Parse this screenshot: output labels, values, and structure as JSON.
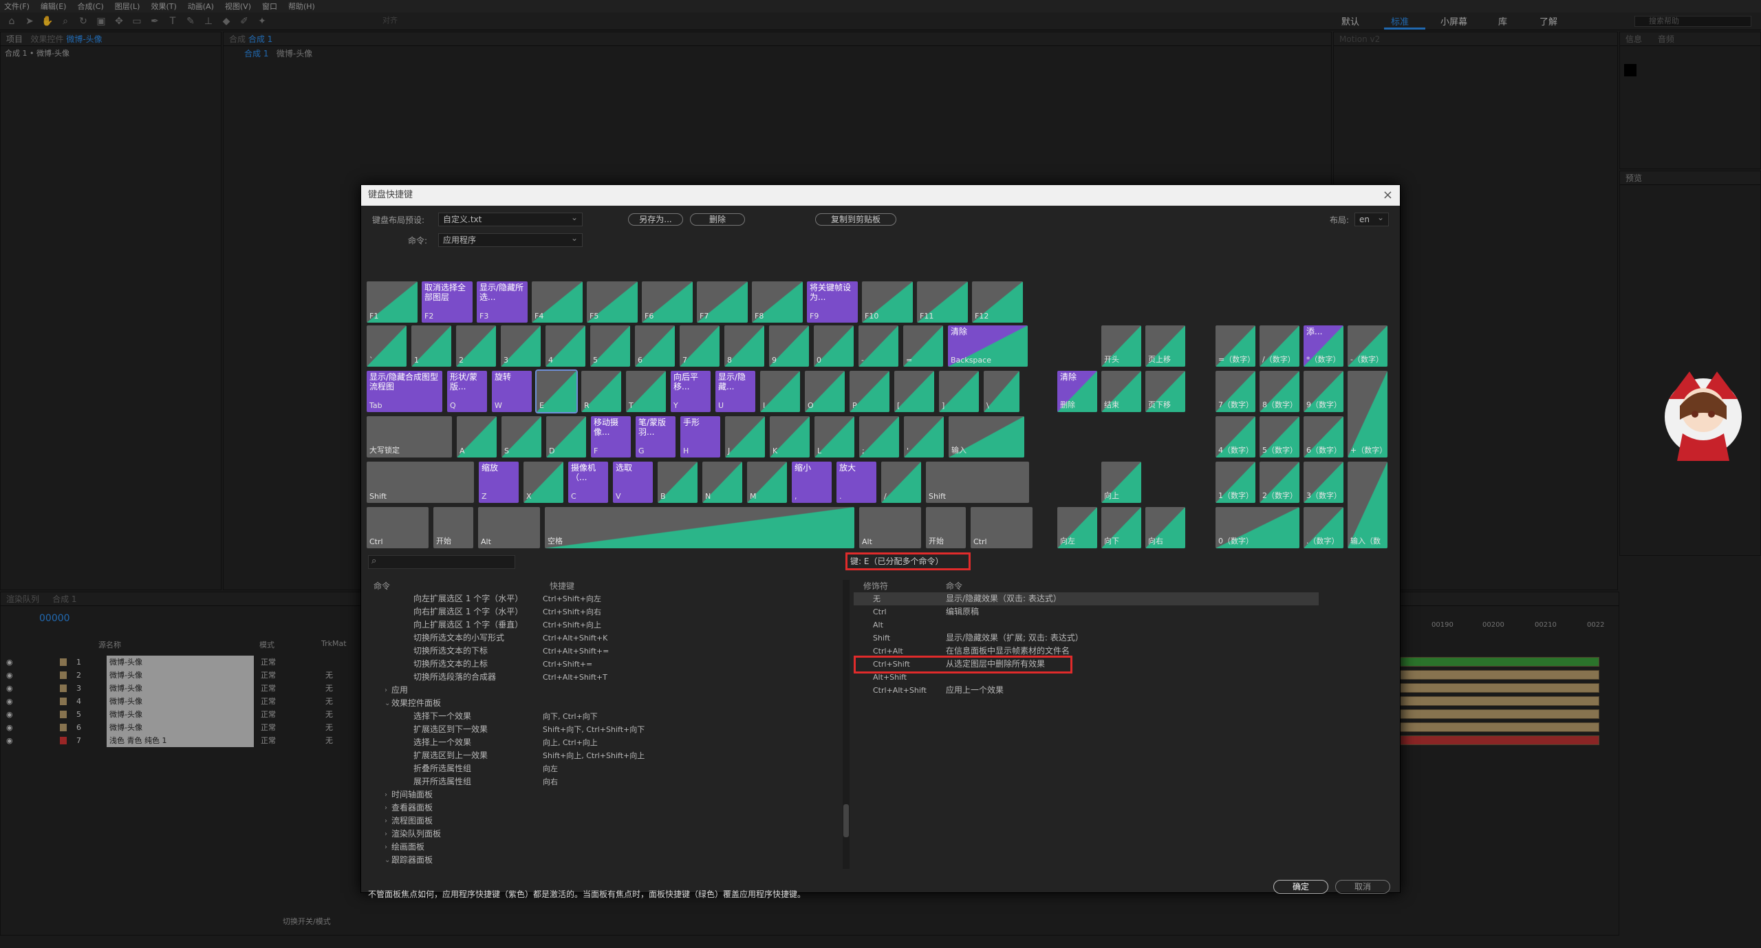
{
  "menu": [
    "文件(F)",
    "编辑(E)",
    "合成(C)",
    "图层(L)",
    "效果(T)",
    "动画(A)",
    "视图(V)",
    "窗口",
    "帮助(H)"
  ],
  "toolbar": {
    "snap": "对齐",
    "search_help": "搜索帮助"
  },
  "workspaces": [
    "默认",
    "标准",
    "小屏幕",
    "库",
    "了解"
  ],
  "panels": {
    "project_tab": "项目",
    "effects_controls_tab": "效果控件",
    "effects_controls_target": "微博-头像",
    "comp_breadcrumb": "合成 1 • 微博-头像",
    "comp_prefix": "合成",
    "comp_name": "合成 1",
    "comp_nav_1": "合成 1",
    "comp_nav_2": "微博-头像",
    "motion_title": "Motion v2",
    "info_tab": "信息",
    "audio_tab": "音频",
    "preview_tab": "预览"
  },
  "timeline": {
    "render_tab": "渲染队列",
    "comp_tab": "合成 1",
    "timecode": "00000",
    "col_source": "源名称",
    "col_mode": "模式",
    "col_trkmat": "TrkMat",
    "toggle_modes": "切换开关/模式",
    "ruler": [
      "00190",
      "00200",
      "00210",
      "0022"
    ],
    "layers": [
      {
        "num": "1",
        "name": "微博-头像",
        "mode": "正常",
        "trk": ""
      },
      {
        "num": "2",
        "name": "微博-头像",
        "mode": "正常",
        "trk": "无"
      },
      {
        "num": "3",
        "name": "微博-头像",
        "mode": "正常",
        "trk": "无"
      },
      {
        "num": "4",
        "name": "微博-头像",
        "mode": "正常",
        "trk": "无"
      },
      {
        "num": "5",
        "name": "微博-头像",
        "mode": "正常",
        "trk": "无"
      },
      {
        "num": "6",
        "name": "微博-头像",
        "mode": "正常",
        "trk": "无"
      },
      {
        "num": "7",
        "name": "浅色 青色 纯色 1",
        "mode": "正常",
        "trk": "无"
      }
    ]
  },
  "dialog": {
    "title": "键盘快捷键",
    "preset_label": "键盘布局预设:",
    "preset_value": "自定义.txt",
    "save_as": "另存为...",
    "delete": "删除",
    "copy": "复制到剪贴板",
    "layout_label": "布局:",
    "layout_value": "en",
    "command_label": "命令:",
    "command_value": "应用程序",
    "key_info": "键: E（已分配多个命令）",
    "col_command": "命令",
    "col_shortcut": "快捷键",
    "col_modifier": "修饰符",
    "col_command2": "命令",
    "footer": "不管面板焦点如何，应用程序快捷键（紫色）都是激活的。当面板有焦点时，面板快捷键（绿色）覆盖应用程序快捷键。",
    "ok": "确定",
    "cancel": "取消",
    "commands": [
      {
        "indent": 3,
        "name": "向左扩展选区 1 个字（水平）",
        "key": "Ctrl+Shift+向左"
      },
      {
        "indent": 3,
        "name": "向右扩展选区 1 个字（水平）",
        "key": "Ctrl+Shift+向右"
      },
      {
        "indent": 3,
        "name": "向上扩展选区 1 个字（垂直）",
        "key": "Ctrl+Shift+向上"
      },
      {
        "indent": 3,
        "name": "切换所选文本的小写形式",
        "key": "Ctrl+Alt+Shift+K"
      },
      {
        "indent": 3,
        "name": "切换所选文本的下标",
        "key": "Ctrl+Alt+Shift+="
      },
      {
        "indent": 3,
        "name": "切换所选文本的上标",
        "key": "Ctrl+Shift+="
      },
      {
        "indent": 3,
        "name": "切换所选段落的合成器",
        "key": "Ctrl+Alt+Shift+T"
      },
      {
        "indent": 1,
        "name": "应用",
        "key": "",
        "arrow": "›"
      },
      {
        "indent": 1,
        "name": "效果控件面板",
        "key": "",
        "arrow": "⌄"
      },
      {
        "indent": 3,
        "name": "选择下一个效果",
        "key": "向下, Ctrl+向下"
      },
      {
        "indent": 3,
        "name": "扩展选区到下一效果",
        "key": "Shift+向下, Ctrl+Shift+向下"
      },
      {
        "indent": 3,
        "name": "选择上一个效果",
        "key": "向上, Ctrl+向上"
      },
      {
        "indent": 3,
        "name": "扩展选区到上一效果",
        "key": "Shift+向上, Ctrl+Shift+向上"
      },
      {
        "indent": 3,
        "name": "折叠所选属性组",
        "key": "向左"
      },
      {
        "indent": 3,
        "name": "展开所选属性组",
        "key": "向右"
      },
      {
        "indent": 1,
        "name": "时间轴面板",
        "key": "",
        "arrow": "›"
      },
      {
        "indent": 1,
        "name": "查看器面板",
        "key": "",
        "arrow": "›"
      },
      {
        "indent": 1,
        "name": "流程图面板",
        "key": "",
        "arrow": "›"
      },
      {
        "indent": 1,
        "name": "渲染队列面板",
        "key": "",
        "arrow": "›"
      },
      {
        "indent": 1,
        "name": "绘画面板",
        "key": "",
        "arrow": "›"
      },
      {
        "indent": 1,
        "name": "跟踪器面板",
        "key": "",
        "arrow": "⌄"
      }
    ],
    "modifiers": [
      {
        "mod": "无",
        "cmd": "显示/隐藏效果（双击: 表达式）"
      },
      {
        "mod": "Ctrl",
        "cmd": "编辑原稿"
      },
      {
        "mod": "Alt",
        "cmd": ""
      },
      {
        "mod": "Shift",
        "cmd": "显示/隐藏效果（扩展; 双击: 表达式）"
      },
      {
        "mod": "Ctrl+Alt",
        "cmd": "在信息面板中显示帧素材的文件名"
      },
      {
        "mod": "Ctrl+Shift",
        "cmd": "从选定图层中删除所有效果"
      },
      {
        "mod": "Alt+Shift",
        "cmd": ""
      },
      {
        "mod": "Ctrl+Alt+Shift",
        "cmd": "应用上一个效果"
      }
    ],
    "keys": [
      {
        "k": "F1",
        "t": "g"
      },
      {
        "k": "F2",
        "t": "p",
        "c": "取消选择全部图层"
      },
      {
        "k": "F3",
        "t": "p",
        "c": "显示/隐藏所选..."
      },
      {
        "k": "F4",
        "t": "g"
      },
      {
        "k": "F5",
        "t": "g"
      },
      {
        "k": "F6",
        "t": "g"
      },
      {
        "k": "F7",
        "t": "g"
      },
      {
        "k": "F8",
        "t": "g"
      },
      {
        "k": "F9",
        "t": "p",
        "c": "将关键帧设为..."
      },
      {
        "k": "F10",
        "t": "g"
      },
      {
        "k": "F11",
        "t": "g"
      },
      {
        "k": "F12",
        "t": "g"
      },
      {
        "k": "`",
        "t": "g"
      },
      {
        "k": "1",
        "t": "g"
      },
      {
        "k": "2",
        "t": "g"
      },
      {
        "k": "3",
        "t": "g"
      },
      {
        "k": "4",
        "t": "g"
      },
      {
        "k": "5",
        "t": "g"
      },
      {
        "k": "6",
        "t": "g"
      },
      {
        "k": "7",
        "t": "g"
      },
      {
        "k": "8",
        "t": "g"
      },
      {
        "k": "9",
        "t": "g"
      },
      {
        "k": "0",
        "t": "g"
      },
      {
        "k": "-",
        "t": "g"
      },
      {
        "k": "=",
        "t": "g"
      },
      {
        "k": "Backspace",
        "t": "m",
        "c": "清除"
      },
      {
        "k": "Tab",
        "t": "p",
        "c": "显示/隐藏合成图型流程图"
      },
      {
        "k": "Q",
        "t": "p",
        "c": "形状/蒙版..."
      },
      {
        "k": "W",
        "t": "p",
        "c": "旋转"
      },
      {
        "k": "E",
        "t": "g"
      },
      {
        "k": "R",
        "t": "g"
      },
      {
        "k": "T",
        "t": "g"
      },
      {
        "k": "Y",
        "t": "p",
        "c": "向后平移..."
      },
      {
        "k": "U",
        "t": "p",
        "c": "显示/隐藏..."
      },
      {
        "k": "I",
        "t": "g"
      },
      {
        "k": "O",
        "t": "g"
      },
      {
        "k": "P",
        "t": "g"
      },
      {
        "k": "[",
        "t": "g"
      },
      {
        "k": "]",
        "t": "g"
      },
      {
        "k": "\\",
        "t": "g"
      },
      {
        "k": "大写锁定",
        "t": "n"
      },
      {
        "k": "A",
        "t": "g"
      },
      {
        "k": "S",
        "t": "g"
      },
      {
        "k": "D",
        "t": "g"
      },
      {
        "k": "F",
        "t": "p",
        "c": "移动摄像..."
      },
      {
        "k": "G",
        "t": "p",
        "c": "笔/蒙版羽..."
      },
      {
        "k": "H",
        "t": "p",
        "c": "手形"
      },
      {
        "k": "J",
        "t": "g"
      },
      {
        "k": "K",
        "t": "g"
      },
      {
        "k": "L",
        "t": "g"
      },
      {
        "k": ";",
        "t": "g"
      },
      {
        "k": "'",
        "t": "g"
      },
      {
        "k": "输入",
        "t": "g"
      },
      {
        "k": "Shift",
        "t": "n"
      },
      {
        "k": "Z",
        "t": "p",
        "c": "缩放"
      },
      {
        "k": "X",
        "t": "g"
      },
      {
        "k": "C",
        "t": "p",
        "c": "摄像机（..."
      },
      {
        "k": "V",
        "t": "p",
        "c": "选取"
      },
      {
        "k": "B",
        "t": "g"
      },
      {
        "k": "N",
        "t": "g"
      },
      {
        "k": "M",
        "t": "g"
      },
      {
        "k": ",",
        "t": "p",
        "c": "缩小"
      },
      {
        "k": ".",
        "t": "p",
        "c": "放大"
      },
      {
        "k": "/",
        "t": "g"
      },
      {
        "k": "Shift",
        "t": "n"
      },
      {
        "k": "Ctrl",
        "t": "n"
      },
      {
        "k": "开始",
        "t": "n"
      },
      {
        "k": "Alt",
        "t": "n"
      },
      {
        "k": "空格",
        "t": "g"
      },
      {
        "k": "Alt",
        "t": "n"
      },
      {
        "k": "开始",
        "t": "n"
      },
      {
        "k": "Ctrl",
        "t": "n"
      },
      {
        "k": "开头",
        "t": "g"
      },
      {
        "k": "页上移",
        "t": "g"
      },
      {
        "k": "删除",
        "t": "m",
        "c": "清除"
      },
      {
        "k": "结束",
        "t": "g"
      },
      {
        "k": "页下移",
        "t": "g"
      },
      {
        "k": "向上",
        "t": "g"
      },
      {
        "k": "向左",
        "t": "g"
      },
      {
        "k": "向下",
        "t": "g"
      },
      {
        "k": "向右",
        "t": "g"
      },
      {
        "k": "=（数字）",
        "t": "g"
      },
      {
        "k": "/（数字）",
        "t": "g"
      },
      {
        "k": "*（数字）",
        "t": "m",
        "c": "添..."
      },
      {
        "k": "-（数字）",
        "t": "g"
      },
      {
        "k": "7（数字）",
        "t": "g"
      },
      {
        "k": "8（数字）",
        "t": "g"
      },
      {
        "k": "9（数字）",
        "t": "g"
      },
      {
        "k": "+（数字）",
        "t": "g"
      },
      {
        "k": "4（数字）",
        "t": "g"
      },
      {
        "k": "5（数字）",
        "t": "g"
      },
      {
        "k": "6（数字）",
        "t": "g"
      },
      {
        "k": "1（数字）",
        "t": "g"
      },
      {
        "k": "2（数字）",
        "t": "g"
      },
      {
        "k": "3（数字）",
        "t": "g"
      },
      {
        "k": "输入（数",
        "t": "g"
      },
      {
        "k": "0（数字）",
        "t": "g"
      },
      {
        "k": ".（数字）",
        "t": "g"
      }
    ]
  }
}
